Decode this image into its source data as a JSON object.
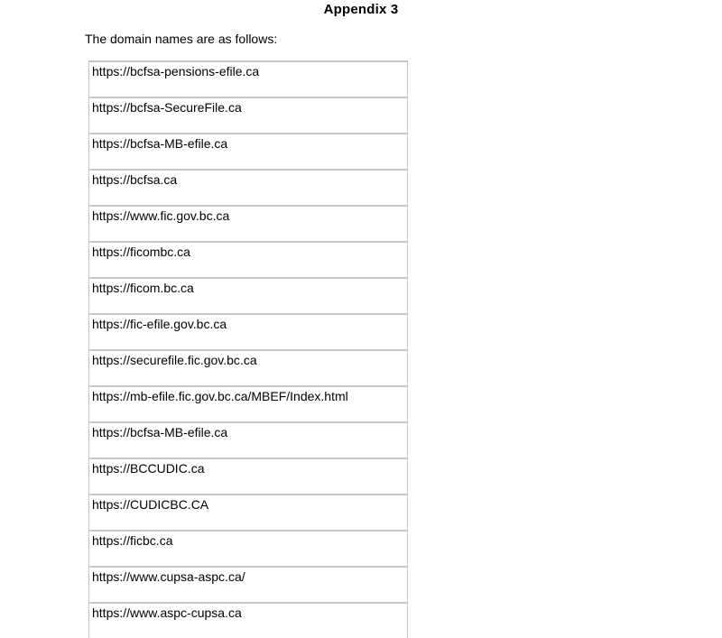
{
  "document": {
    "title": "Appendix 3",
    "intro": "The domain names are as follows:",
    "domains": [
      "https://bcfsa-pensions-efile.ca",
      "https://bcfsa-SecureFile.ca",
      "https://bcfsa-MB-efile.ca",
      "https://bcfsa.ca",
      "https://www.fic.gov.bc.ca",
      "https://ficombc.ca",
      "https://ficom.bc.ca",
      "https://fic-efile.gov.bc.ca",
      "https://securefile.fic.gov.bc.ca",
      "https://mb-efile.fic.gov.bc.ca/MBEF/Index.html",
      "https://bcfsa-MB-efile.ca",
      "https://BCCUDIC.ca",
      "https://CUDICBC.CA",
      "https://ficbc.ca",
      "https://www.cupsa-aspc.ca/",
      "https://www.aspc-cupsa.ca"
    ]
  }
}
